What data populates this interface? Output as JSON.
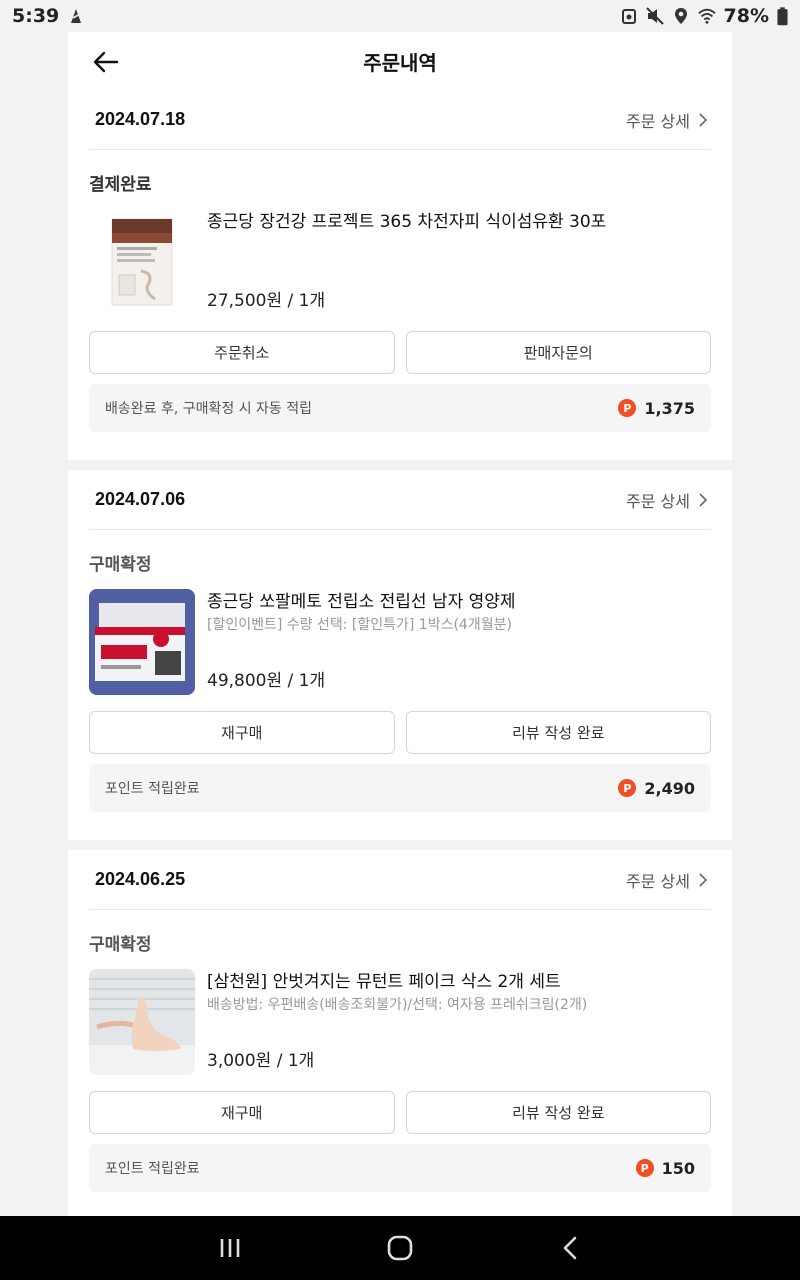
{
  "status_bar": {
    "time": "5:39",
    "battery": "78%",
    "icons": [
      "notification-icon",
      "recycle-icon",
      "mute-icon",
      "location-icon",
      "wifi-icon",
      "battery-icon"
    ]
  },
  "header": {
    "title": "주문내역",
    "back_icon": "arrow-left-icon"
  },
  "orders": [
    {
      "date": "2024.07.18",
      "detail_label": "주문 상세",
      "status": "결제완료",
      "product_name": "종근당 장건강 프로젝트 365 차전자피 식이섬유환 30포",
      "product_option": "",
      "price": "27,500원 / 1개",
      "buttons": [
        "주문취소",
        "판매자문의"
      ],
      "point_text": "배송완료 후, 구매확정 시 자동 적립",
      "point_value": "1,375",
      "thumb_icon": "fiber-supplement-box-image"
    },
    {
      "date": "2024.07.06",
      "detail_label": "주문 상세",
      "status": "구매확정",
      "product_name": "종근당 쏘팔메토 전립소 전립선 남자 영양제",
      "product_option": "[할인이벤트] 수량 선택: [할인특가] 1박스(4개월분)",
      "price": "49,800원 / 1개",
      "buttons": [
        "재구매",
        "리뷰 작성 완료"
      ],
      "point_text": "포인트 적립완료",
      "point_value": "2,490",
      "thumb_icon": "saw-palmetto-box-image"
    },
    {
      "date": "2024.06.25",
      "detail_label": "주문 상세",
      "status": "구매확정",
      "product_name": "[삼천원] 안벗겨지는 뮤턴트 페이크 삭스 2개 세트",
      "product_option": "배송방법: 우편배송(배송조회불가)/선택: 여자용 프레쉬크림(2개)",
      "price": "3,000원 / 1개",
      "buttons": [
        "재구매",
        "리뷰 작성 완료"
      ],
      "point_text": "포인트 적립완료",
      "point_value": "150",
      "thumb_icon": "foot-sock-photo-image"
    }
  ],
  "point_badge": "P",
  "nav": {
    "icons": [
      "recent-apps-icon",
      "home-icon",
      "back-icon"
    ]
  },
  "colors": {
    "point_badge": "#f04e23",
    "nav_bg": "#000000",
    "page_bg": "#f2f2f2"
  }
}
